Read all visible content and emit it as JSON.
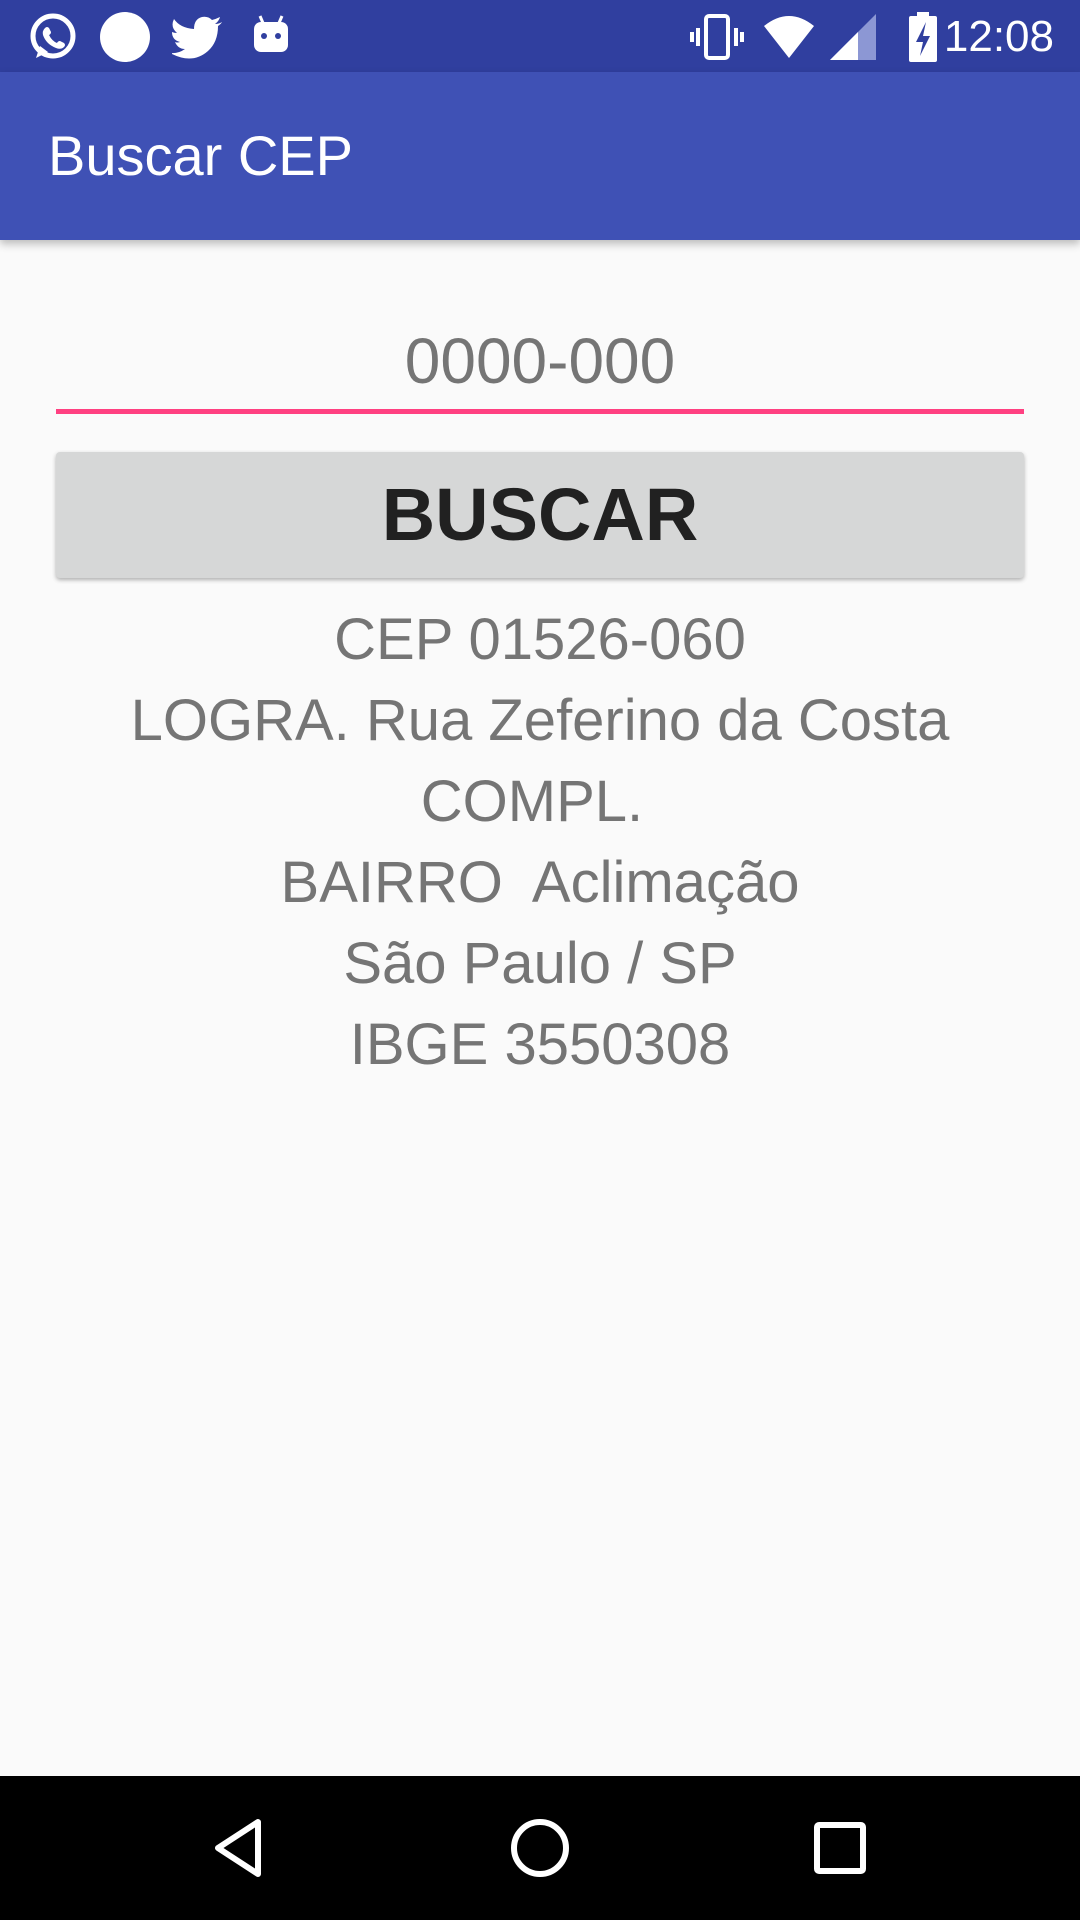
{
  "status_bar": {
    "time": "12:08",
    "notification_icons": [
      "whatsapp-icon",
      "circle-icon",
      "twitter-icon",
      "android-icon"
    ],
    "system_icons": [
      "vibrate-icon",
      "wifi-icon",
      "cell-signal-icon",
      "battery-charging-icon"
    ],
    "color": "#303f9f"
  },
  "app_bar": {
    "title": "Buscar CEP",
    "color": "#3f51b5"
  },
  "form": {
    "cep_placeholder": "0000-000",
    "cep_value": "",
    "search_button_label": "BUSCAR",
    "accent_color": "#ff4081"
  },
  "result": {
    "lines": [
      "CEP 01526-060",
      "LOGRA. Rua Zeferino da Costa",
      "COMPL. ",
      "BAIRRO  Aclimação",
      "São Paulo / SP",
      "IBGE 3550308"
    ]
  },
  "nav_bar": {
    "buttons": [
      "back-icon",
      "home-icon",
      "recents-icon"
    ]
  }
}
